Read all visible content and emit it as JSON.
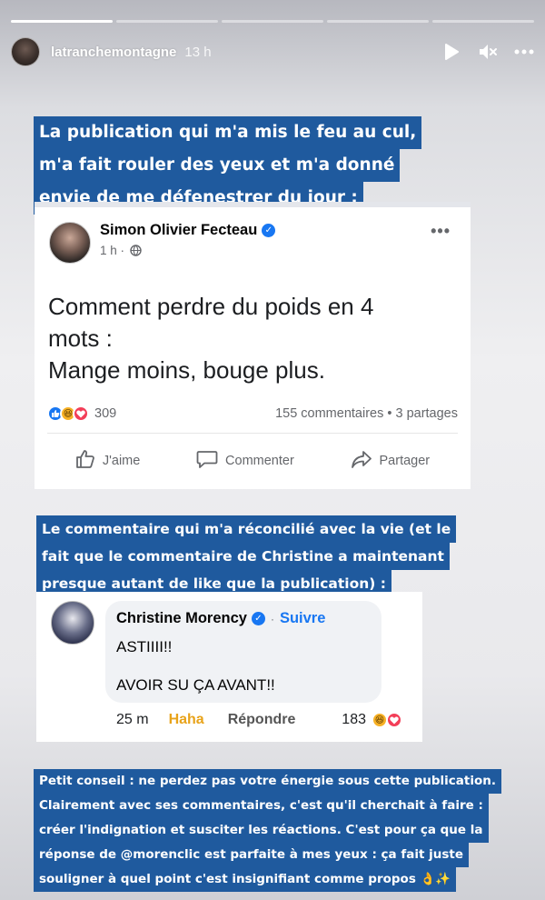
{
  "story": {
    "progress": [
      1.0,
      0.0,
      0.0,
      0.0,
      0.0
    ],
    "username": "latranchemontagne",
    "time": "13 h",
    "icons": [
      "play-icon",
      "mute-icon",
      "more-icon"
    ]
  },
  "captions": {
    "top": [
      "La publication qui m'a mis le feu au cul,",
      "m'a fait rouler des yeux et m'a donné",
      "envie de me défenestrer du jour :"
    ],
    "middle": [
      "Le commentaire qui m'a réconcilié avec la vie (et le",
      "fait que le commentaire de Christine a maintenant",
      "presque autant de like que la publication) :"
    ],
    "bottom": [
      "Petit conseil : ne perdez pas votre énergie sous cette publication.",
      "Clairement avec ses commentaires, c'est qu'il cherchait à faire :",
      "créer l'indignation et susciter les réactions. C'est pour ça que la",
      "réponse de @morenclic est parfaite à mes yeux : ça fait juste",
      "souligner à quel point c'est insignifiant comme propos 👌✨"
    ]
  },
  "post": {
    "author": "Simon Olivier Fecteau",
    "time": "1 h ·",
    "text": [
      "Comment perdre du poids en 4",
      "mots :",
      "Mange moins, bouge plus."
    ],
    "reaction_count": "309",
    "comments_shares": "155 commentaires • 3 partages",
    "actions": {
      "like": "J'aime",
      "comment": "Commenter",
      "share": "Partager"
    },
    "colors": {
      "like": "#1877f2",
      "haha": "#f7b125",
      "love": "#f33e58"
    }
  },
  "comment": {
    "author": "Christine Morency",
    "follow": "Suivre",
    "dot": "·",
    "text_line1": "ASTIIII!!",
    "text_line2": "AVOIR SU ÇA AVANT!!",
    "time": "25 m",
    "reaction_label": "Haha",
    "reply_label": "Répondre",
    "reaction_count": "183"
  },
  "colors": {
    "caption_bg": "#1f5a9e",
    "fb_blue": "#1877f2"
  }
}
